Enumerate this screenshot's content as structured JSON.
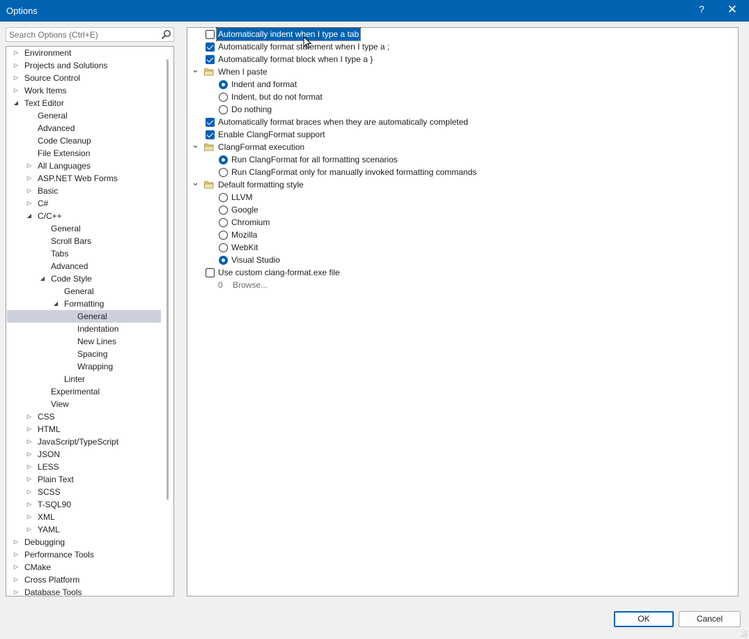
{
  "window": {
    "title": "Options",
    "help_glyph": "?",
    "close_glyph": "✕"
  },
  "search": {
    "placeholder": "Search Options (Ctrl+E)",
    "value": ""
  },
  "tree": [
    {
      "label": "Environment",
      "level": 0,
      "expander": "collapsed"
    },
    {
      "label": "Projects and Solutions",
      "level": 0,
      "expander": "collapsed"
    },
    {
      "label": "Source Control",
      "level": 0,
      "expander": "collapsed"
    },
    {
      "label": "Work Items",
      "level": 0,
      "expander": "collapsed"
    },
    {
      "label": "Text Editor",
      "level": 0,
      "expander": "expanded"
    },
    {
      "label": "General",
      "level": 1,
      "expander": "none"
    },
    {
      "label": "Advanced",
      "level": 1,
      "expander": "none"
    },
    {
      "label": "Code Cleanup",
      "level": 1,
      "expander": "none"
    },
    {
      "label": "File Extension",
      "level": 1,
      "expander": "none"
    },
    {
      "label": "All Languages",
      "level": 1,
      "expander": "collapsed"
    },
    {
      "label": "ASP.NET Web Forms",
      "level": 1,
      "expander": "collapsed"
    },
    {
      "label": "Basic",
      "level": 1,
      "expander": "collapsed"
    },
    {
      "label": "C#",
      "level": 1,
      "expander": "collapsed"
    },
    {
      "label": "C/C++",
      "level": 1,
      "expander": "expanded"
    },
    {
      "label": "General",
      "level": 2,
      "expander": "none"
    },
    {
      "label": "Scroll Bars",
      "level": 2,
      "expander": "none"
    },
    {
      "label": "Tabs",
      "level": 2,
      "expander": "none"
    },
    {
      "label": "Advanced",
      "level": 2,
      "expander": "none"
    },
    {
      "label": "Code Style",
      "level": 2,
      "expander": "expanded"
    },
    {
      "label": "General",
      "level": 3,
      "expander": "none"
    },
    {
      "label": "Formatting",
      "level": 3,
      "expander": "expanded"
    },
    {
      "label": "General",
      "level": 4,
      "expander": "none",
      "selected": true
    },
    {
      "label": "Indentation",
      "level": 4,
      "expander": "none"
    },
    {
      "label": "New Lines",
      "level": 4,
      "expander": "none"
    },
    {
      "label": "Spacing",
      "level": 4,
      "expander": "none"
    },
    {
      "label": "Wrapping",
      "level": 4,
      "expander": "none"
    },
    {
      "label": "Linter",
      "level": 3,
      "expander": "none"
    },
    {
      "label": "Experimental",
      "level": 2,
      "expander": "none"
    },
    {
      "label": "View",
      "level": 2,
      "expander": "none"
    },
    {
      "label": "CSS",
      "level": 1,
      "expander": "collapsed"
    },
    {
      "label": "HTML",
      "level": 1,
      "expander": "collapsed"
    },
    {
      "label": "JavaScript/TypeScript",
      "level": 1,
      "expander": "collapsed"
    },
    {
      "label": "JSON",
      "level": 1,
      "expander": "collapsed"
    },
    {
      "label": "LESS",
      "level": 1,
      "expander": "collapsed"
    },
    {
      "label": "Plain Text",
      "level": 1,
      "expander": "collapsed"
    },
    {
      "label": "SCSS",
      "level": 1,
      "expander": "collapsed"
    },
    {
      "label": "T-SQL90",
      "level": 1,
      "expander": "collapsed"
    },
    {
      "label": "XML",
      "level": 1,
      "expander": "collapsed"
    },
    {
      "label": "YAML",
      "level": 1,
      "expander": "collapsed"
    },
    {
      "label": "Debugging",
      "level": 0,
      "expander": "collapsed"
    },
    {
      "label": "Performance Tools",
      "level": 0,
      "expander": "collapsed"
    },
    {
      "label": "CMake",
      "level": 0,
      "expander": "collapsed"
    },
    {
      "label": "Cross Platform",
      "level": 0,
      "expander": "collapsed"
    },
    {
      "label": "Database Tools",
      "level": 0,
      "expander": "collapsed"
    }
  ],
  "settings": [
    {
      "kind": "checkbox",
      "label": "Automatically indent when I type a tab",
      "checked": false,
      "indent": 0,
      "focused": true
    },
    {
      "kind": "checkbox",
      "label": "Automatically format statement when I type a ;",
      "checked": true,
      "indent": 0
    },
    {
      "kind": "checkbox",
      "label": "Automatically format block when I type a }",
      "checked": true,
      "indent": 0
    },
    {
      "kind": "group",
      "label": "When I paste",
      "indent": 0
    },
    {
      "kind": "radio",
      "label": "Indent and format",
      "checked": true,
      "indent": 1
    },
    {
      "kind": "radio",
      "label": "Indent, but do not format",
      "checked": false,
      "indent": 1
    },
    {
      "kind": "radio",
      "label": "Do nothing",
      "checked": false,
      "indent": 1
    },
    {
      "kind": "checkbox",
      "label": "Automatically format braces when they are automatically completed",
      "checked": true,
      "indent": 0
    },
    {
      "kind": "checkbox",
      "label": "Enable ClangFormat support",
      "checked": true,
      "indent": 0
    },
    {
      "kind": "group",
      "label": "ClangFormat execution",
      "indent": 0
    },
    {
      "kind": "radio",
      "label": "Run ClangFormat for all formatting scenarios",
      "checked": true,
      "indent": 1
    },
    {
      "kind": "radio",
      "label": "Run ClangFormat only for manually invoked formatting commands",
      "checked": false,
      "indent": 1
    },
    {
      "kind": "group",
      "label": "Default formatting style",
      "indent": 0
    },
    {
      "kind": "radio",
      "label": "LLVM",
      "checked": false,
      "indent": 1
    },
    {
      "kind": "radio",
      "label": "Google",
      "checked": false,
      "indent": 1
    },
    {
      "kind": "radio",
      "label": "Chromium",
      "checked": false,
      "indent": 1
    },
    {
      "kind": "radio",
      "label": "Mozilla",
      "checked": false,
      "indent": 1
    },
    {
      "kind": "radio",
      "label": "WebKit",
      "checked": false,
      "indent": 1
    },
    {
      "kind": "radio",
      "label": "Visual Studio",
      "checked": true,
      "indent": 1
    },
    {
      "kind": "checkbox",
      "label": "Use custom clang-format.exe file",
      "checked": false,
      "indent": 0
    },
    {
      "kind": "path",
      "value": "0",
      "browse_label": "Browse...",
      "indent": 1
    }
  ],
  "buttons": {
    "ok_label": "OK",
    "cancel_label": "Cancel"
  },
  "colors": {
    "titlebar": "#0063b1",
    "accent": "#005fb8",
    "selection": "#ccd0dc",
    "folder": "#dcc77a"
  }
}
